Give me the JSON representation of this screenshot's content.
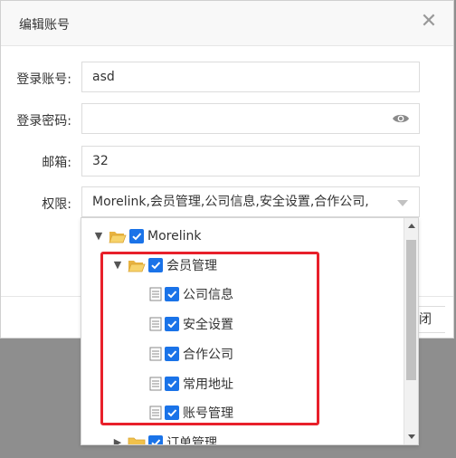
{
  "dialog": {
    "title": "编辑账号",
    "close_symbol": "✕"
  },
  "form": {
    "account": {
      "label": "登录账号:",
      "value": "asd"
    },
    "password": {
      "label": "登录密码:",
      "value": ""
    },
    "email": {
      "label": "邮箱:",
      "value": "32"
    },
    "permission": {
      "label": "权限:",
      "value": "Morelink,会员管理,公司信息,安全设置,合作公司,"
    }
  },
  "footer": {
    "close_partial": "闭"
  },
  "tree": {
    "root": {
      "label": "Morelink",
      "expanded": true,
      "checked": true
    },
    "group1": {
      "label": "会员管理",
      "expanded": true,
      "checked": true,
      "children": [
        {
          "label": "公司信息",
          "checked": true
        },
        {
          "label": "安全设置",
          "checked": true
        },
        {
          "label": "合作公司",
          "checked": true
        },
        {
          "label": "常用地址",
          "checked": true
        },
        {
          "label": "账号管理",
          "checked": true
        }
      ]
    },
    "group2": {
      "label": "订单管理",
      "expanded": false,
      "checked": true
    }
  },
  "colors": {
    "accent": "#1a73e8",
    "highlight": "#e8202a",
    "overlay": "#8e8e8e"
  }
}
